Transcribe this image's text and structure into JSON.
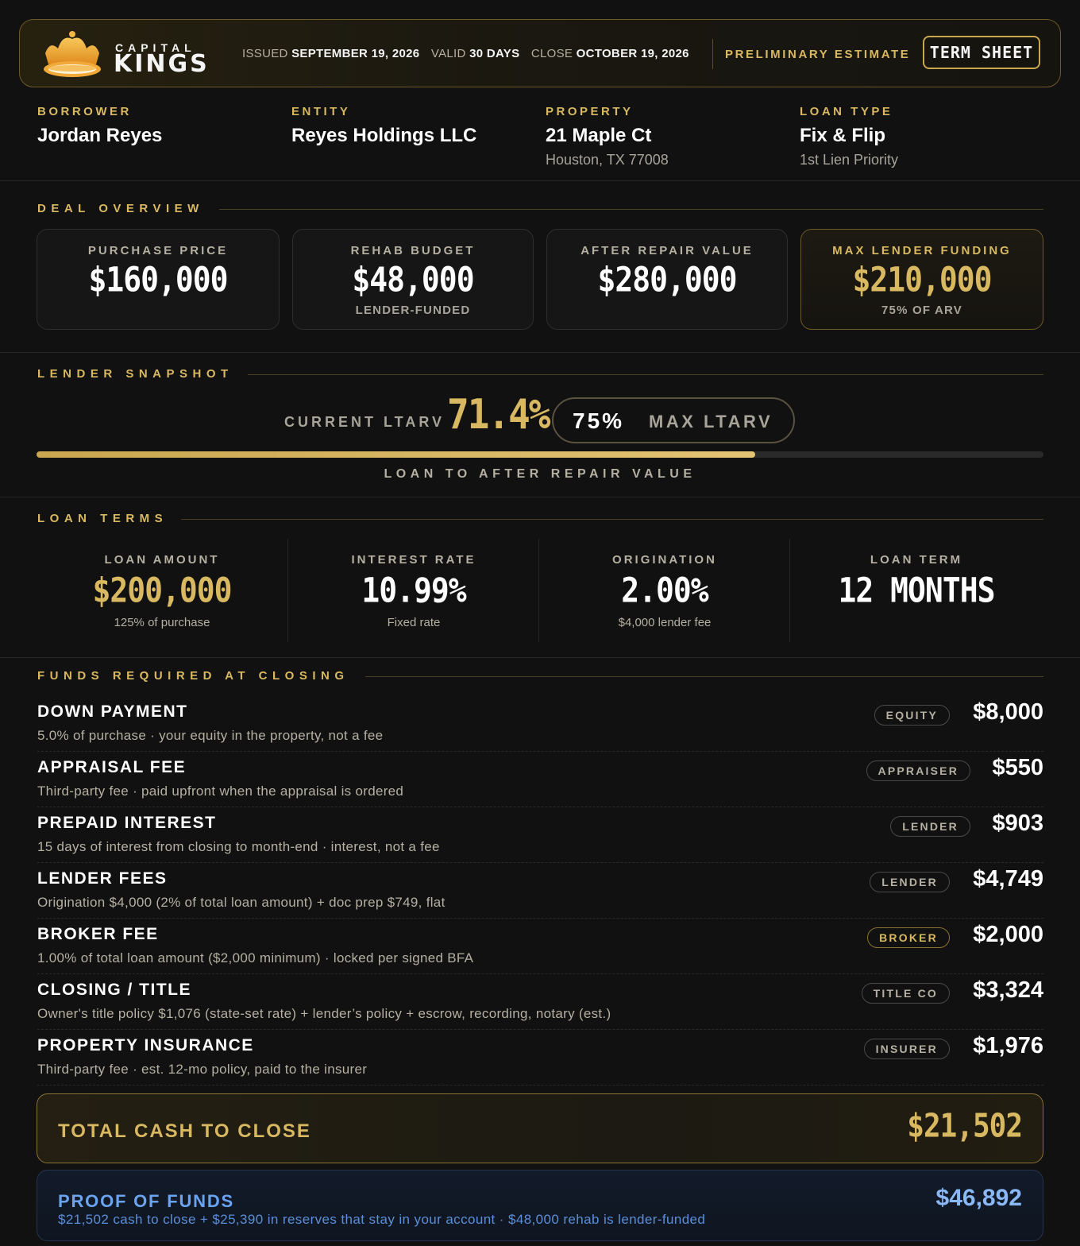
{
  "header": {
    "brand_top": "CAPITAL",
    "brand_bottom": "KINGS",
    "issued_label": "ISSUED",
    "issued_value": "SEPTEMBER 19, 2026",
    "valid_label": "VALID",
    "valid_value": "30 DAYS",
    "close_label": "CLOSE",
    "close_value": "OCTOBER 19, 2026",
    "status": "PRELIMINARY ESTIMATE",
    "doc_type": "TERM SHEET"
  },
  "info": {
    "borrower": {
      "label": "BORROWER",
      "value": "Jordan Reyes"
    },
    "entity": {
      "label": "ENTITY",
      "value": "Reyes Holdings LLC"
    },
    "property": {
      "label": "PROPERTY",
      "value": "21 Maple Ct",
      "sub": "Houston, TX 77008"
    },
    "loan_type": {
      "label": "LOAN TYPE",
      "value": "Fix & Flip",
      "sub": "1st Lien Priority"
    }
  },
  "deal_overview": {
    "title": "DEAL OVERVIEW",
    "cards": [
      {
        "label": "PURCHASE PRICE",
        "value": "$160,000",
        "sub": ""
      },
      {
        "label": "REHAB BUDGET",
        "value": "$48,000",
        "sub": "LENDER-FUNDED"
      },
      {
        "label": "AFTER REPAIR VALUE",
        "value": "$280,000",
        "sub": ""
      },
      {
        "label": "MAX LENDER FUNDING",
        "value": "$210,000",
        "sub": "75% OF ARV"
      }
    ]
  },
  "snapshot": {
    "title": "LENDER SNAPSHOT",
    "current_label": "CURRENT LTARV",
    "current_value": "71.4%",
    "current_fraction": 0.714,
    "max_value": "75%",
    "max_label": "MAX LTARV",
    "caption": "LOAN TO AFTER REPAIR VALUE"
  },
  "loan_terms": {
    "title": "LOAN TERMS",
    "items": [
      {
        "label": "LOAN AMOUNT",
        "value": "$200,000",
        "sub": "125% of purchase"
      },
      {
        "label": "INTEREST RATE",
        "value": "10.99%",
        "sub": "Fixed rate"
      },
      {
        "label": "ORIGINATION",
        "value": "2.00%",
        "sub": "$4,000 lender fee"
      },
      {
        "label": "LOAN TERM",
        "value": "12 MONTHS",
        "sub": ""
      }
    ]
  },
  "funds": {
    "title": "FUNDS REQUIRED AT CLOSING",
    "rows": [
      {
        "name": "DOWN PAYMENT",
        "desc": "5.0% of purchase · your equity in the property, not a fee",
        "tag": "EQUITY",
        "amount": "$8,000"
      },
      {
        "name": "APPRAISAL FEE",
        "desc": "Third-party fee · paid upfront when the appraisal is ordered",
        "tag": "APPRAISER",
        "amount": "$550"
      },
      {
        "name": "PREPAID INTEREST",
        "desc": "15 days of interest from closing to month-end · interest, not a fee",
        "tag": "LENDER",
        "amount": "$903"
      },
      {
        "name": "LENDER FEES",
        "desc": "Origination $4,000 (2% of total loan amount) + doc prep $749, flat",
        "tag": "LENDER",
        "amount": "$4,749"
      },
      {
        "name": "BROKER FEE",
        "desc": "1.00% of total loan amount ($2,000 minimum) · locked per signed BFA",
        "tag": "BROKER",
        "amount": "$2,000"
      },
      {
        "name": "CLOSING / TITLE",
        "desc": "Owner's title policy $1,076 (state-set rate) + lender’s policy + escrow, recording, notary (est.)",
        "tag": "TITLE CO",
        "amount": "$3,324"
      },
      {
        "name": "PROPERTY INSURANCE",
        "desc": "Third-party fee · est. 12-mo policy, paid to the insurer",
        "tag": "INSURER",
        "amount": "$1,976"
      }
    ],
    "total_label": "TOTAL CASH TO CLOSE",
    "total_value": "$21,502"
  },
  "proof": {
    "label": "PROOF OF FUNDS",
    "desc": "$21,502 cash to close + $25,390 in reserves that stay in your account · $48,000 rehab is lender-funded",
    "value": "$46,892"
  },
  "colors": {
    "gold": "#d8b860",
    "background": "#111111",
    "proof_blue": "#6aa4f0"
  }
}
